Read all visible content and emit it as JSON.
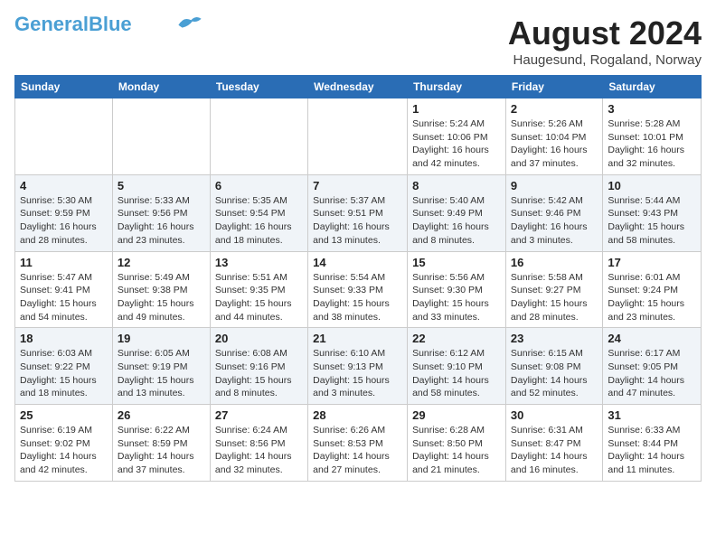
{
  "header": {
    "logo_line1": "General",
    "logo_line2": "Blue",
    "month_year": "August 2024",
    "location": "Haugesund, Rogaland, Norway"
  },
  "days_of_week": [
    "Sunday",
    "Monday",
    "Tuesday",
    "Wednesday",
    "Thursday",
    "Friday",
    "Saturday"
  ],
  "weeks": [
    [
      {
        "day": "",
        "info": ""
      },
      {
        "day": "",
        "info": ""
      },
      {
        "day": "",
        "info": ""
      },
      {
        "day": "",
        "info": ""
      },
      {
        "day": "1",
        "info": "Sunrise: 5:24 AM\nSunset: 10:06 PM\nDaylight: 16 hours\nand 42 minutes."
      },
      {
        "day": "2",
        "info": "Sunrise: 5:26 AM\nSunset: 10:04 PM\nDaylight: 16 hours\nand 37 minutes."
      },
      {
        "day": "3",
        "info": "Sunrise: 5:28 AM\nSunset: 10:01 PM\nDaylight: 16 hours\nand 32 minutes."
      }
    ],
    [
      {
        "day": "4",
        "info": "Sunrise: 5:30 AM\nSunset: 9:59 PM\nDaylight: 16 hours\nand 28 minutes."
      },
      {
        "day": "5",
        "info": "Sunrise: 5:33 AM\nSunset: 9:56 PM\nDaylight: 16 hours\nand 23 minutes."
      },
      {
        "day": "6",
        "info": "Sunrise: 5:35 AM\nSunset: 9:54 PM\nDaylight: 16 hours\nand 18 minutes."
      },
      {
        "day": "7",
        "info": "Sunrise: 5:37 AM\nSunset: 9:51 PM\nDaylight: 16 hours\nand 13 minutes."
      },
      {
        "day": "8",
        "info": "Sunrise: 5:40 AM\nSunset: 9:49 PM\nDaylight: 16 hours\nand 8 minutes."
      },
      {
        "day": "9",
        "info": "Sunrise: 5:42 AM\nSunset: 9:46 PM\nDaylight: 16 hours\nand 3 minutes."
      },
      {
        "day": "10",
        "info": "Sunrise: 5:44 AM\nSunset: 9:43 PM\nDaylight: 15 hours\nand 58 minutes."
      }
    ],
    [
      {
        "day": "11",
        "info": "Sunrise: 5:47 AM\nSunset: 9:41 PM\nDaylight: 15 hours\nand 54 minutes."
      },
      {
        "day": "12",
        "info": "Sunrise: 5:49 AM\nSunset: 9:38 PM\nDaylight: 15 hours\nand 49 minutes."
      },
      {
        "day": "13",
        "info": "Sunrise: 5:51 AM\nSunset: 9:35 PM\nDaylight: 15 hours\nand 44 minutes."
      },
      {
        "day": "14",
        "info": "Sunrise: 5:54 AM\nSunset: 9:33 PM\nDaylight: 15 hours\nand 38 minutes."
      },
      {
        "day": "15",
        "info": "Sunrise: 5:56 AM\nSunset: 9:30 PM\nDaylight: 15 hours\nand 33 minutes."
      },
      {
        "day": "16",
        "info": "Sunrise: 5:58 AM\nSunset: 9:27 PM\nDaylight: 15 hours\nand 28 minutes."
      },
      {
        "day": "17",
        "info": "Sunrise: 6:01 AM\nSunset: 9:24 PM\nDaylight: 15 hours\nand 23 minutes."
      }
    ],
    [
      {
        "day": "18",
        "info": "Sunrise: 6:03 AM\nSunset: 9:22 PM\nDaylight: 15 hours\nand 18 minutes."
      },
      {
        "day": "19",
        "info": "Sunrise: 6:05 AM\nSunset: 9:19 PM\nDaylight: 15 hours\nand 13 minutes."
      },
      {
        "day": "20",
        "info": "Sunrise: 6:08 AM\nSunset: 9:16 PM\nDaylight: 15 hours\nand 8 minutes."
      },
      {
        "day": "21",
        "info": "Sunrise: 6:10 AM\nSunset: 9:13 PM\nDaylight: 15 hours\nand 3 minutes."
      },
      {
        "day": "22",
        "info": "Sunrise: 6:12 AM\nSunset: 9:10 PM\nDaylight: 14 hours\nand 58 minutes."
      },
      {
        "day": "23",
        "info": "Sunrise: 6:15 AM\nSunset: 9:08 PM\nDaylight: 14 hours\nand 52 minutes."
      },
      {
        "day": "24",
        "info": "Sunrise: 6:17 AM\nSunset: 9:05 PM\nDaylight: 14 hours\nand 47 minutes."
      }
    ],
    [
      {
        "day": "25",
        "info": "Sunrise: 6:19 AM\nSunset: 9:02 PM\nDaylight: 14 hours\nand 42 minutes."
      },
      {
        "day": "26",
        "info": "Sunrise: 6:22 AM\nSunset: 8:59 PM\nDaylight: 14 hours\nand 37 minutes."
      },
      {
        "day": "27",
        "info": "Sunrise: 6:24 AM\nSunset: 8:56 PM\nDaylight: 14 hours\nand 32 minutes."
      },
      {
        "day": "28",
        "info": "Sunrise: 6:26 AM\nSunset: 8:53 PM\nDaylight: 14 hours\nand 27 minutes."
      },
      {
        "day": "29",
        "info": "Sunrise: 6:28 AM\nSunset: 8:50 PM\nDaylight: 14 hours\nand 21 minutes."
      },
      {
        "day": "30",
        "info": "Sunrise: 6:31 AM\nSunset: 8:47 PM\nDaylight: 14 hours\nand 16 minutes."
      },
      {
        "day": "31",
        "info": "Sunrise: 6:33 AM\nSunset: 8:44 PM\nDaylight: 14 hours\nand 11 minutes."
      }
    ]
  ]
}
